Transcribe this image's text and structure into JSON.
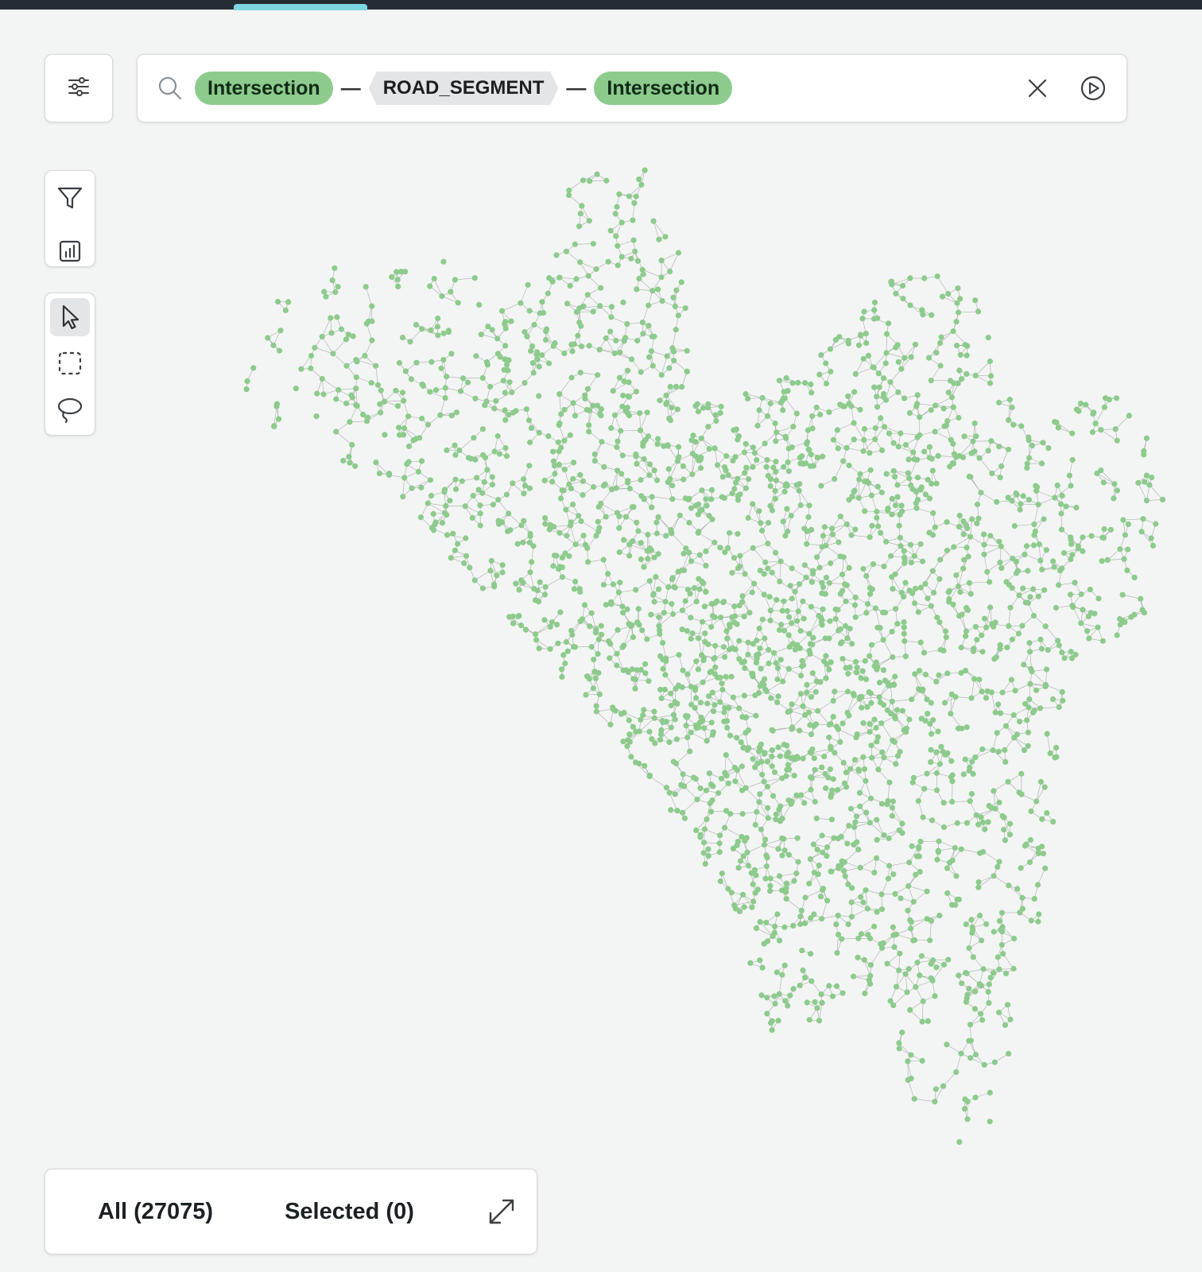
{
  "topbar": {
    "accent_color": "#7fd6e3",
    "background": "#252d33"
  },
  "search": {
    "pattern": {
      "start_node": "Intersection",
      "relationship": "ROAD_SEGMENT",
      "end_node": "Intersection"
    },
    "icons": [
      "search-icon",
      "close-icon",
      "play-icon"
    ]
  },
  "toolbar": {
    "settings_icon": "sliders-icon",
    "panel_tools": [
      "filter-icon",
      "bar-chart-icon"
    ],
    "selection_tools": [
      "pointer-icon",
      "box-select-icon",
      "lasso-icon"
    ],
    "active_selection_tool": "pointer-icon"
  },
  "graph": {
    "node_color": "#8dcb8d",
    "edge_color": "#6e6e6e"
  },
  "results": {
    "all_label": "All (27075)",
    "selected_label": "Selected (0)",
    "expand_icon": "expand-icon"
  }
}
